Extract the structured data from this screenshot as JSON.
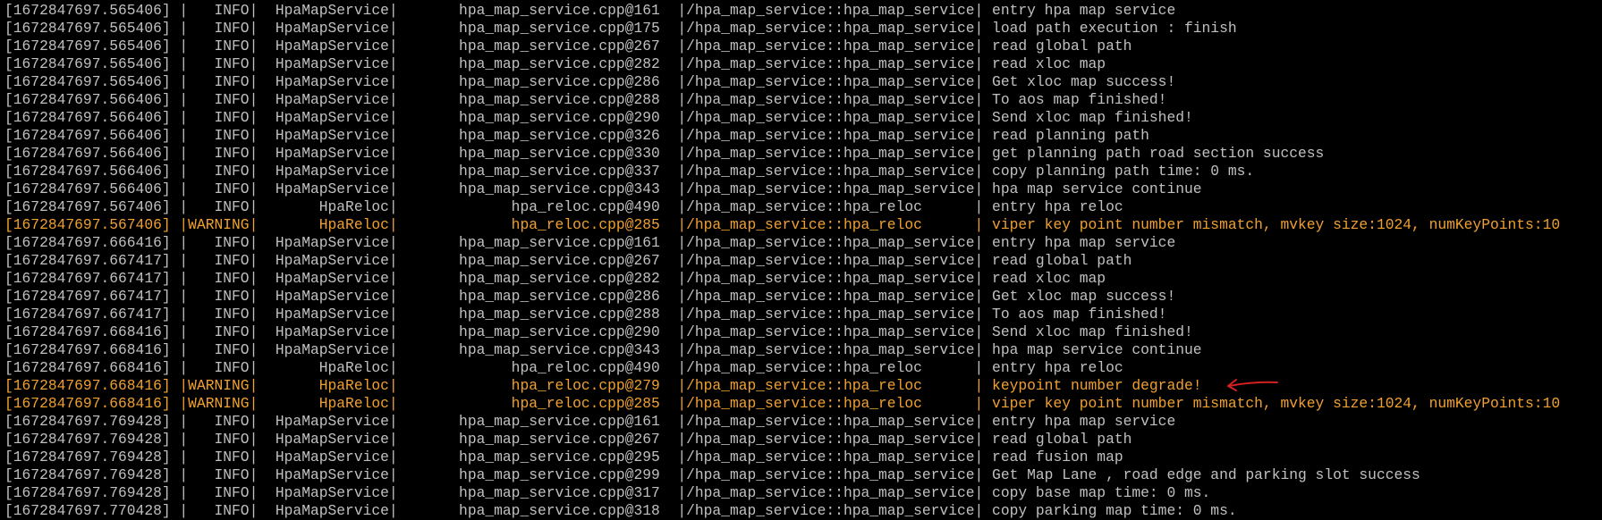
{
  "terminal": {
    "lines": [
      "[1672847697.565406] |   INFO|  HpaMapService|       hpa_map_service.cpp@161  |/hpa_map_service::hpa_map_service| entry hpa map service",
      "[1672847697.565406] |   INFO|  HpaMapService|       hpa_map_service.cpp@175  |/hpa_map_service::hpa_map_service| load path execution : finish",
      "[1672847697.565406] |   INFO|  HpaMapService|       hpa_map_service.cpp@267  |/hpa_map_service::hpa_map_service| read global path",
      "[1672847697.565406] |   INFO|  HpaMapService|       hpa_map_service.cpp@282  |/hpa_map_service::hpa_map_service| read xloc map",
      "[1672847697.565406] |   INFO|  HpaMapService|       hpa_map_service.cpp@286  |/hpa_map_service::hpa_map_service| Get xloc map success!",
      "[1672847697.566406] |   INFO|  HpaMapService|       hpa_map_service.cpp@288  |/hpa_map_service::hpa_map_service| To aos map finished!",
      "[1672847697.566406] |   INFO|  HpaMapService|       hpa_map_service.cpp@290  |/hpa_map_service::hpa_map_service| Send xloc map finished!",
      "[1672847697.566406] |   INFO|  HpaMapService|       hpa_map_service.cpp@326  |/hpa_map_service::hpa_map_service| read planning path",
      "[1672847697.566406] |   INFO|  HpaMapService|       hpa_map_service.cpp@330  |/hpa_map_service::hpa_map_service| get planning path road section success",
      "[1672847697.566406] |   INFO|  HpaMapService|       hpa_map_service.cpp@337  |/hpa_map_service::hpa_map_service| copy planning path time: 0 ms.",
      "[1672847697.566406] |   INFO|  HpaMapService|       hpa_map_service.cpp@343  |/hpa_map_service::hpa_map_service| hpa map service continue",
      "[1672847697.567406] |   INFO|       HpaReloc|             hpa_reloc.cpp@490  |/hpa_map_service::hpa_reloc      | entry hpa reloc",
      "[1672847697.567406] |WARNING|       HpaReloc|             hpa_reloc.cpp@285  |/hpa_map_service::hpa_reloc      | viper key point number mismatch, mvkey size:1024, numKeyPoints:10",
      "[1672847697.666416] |   INFO|  HpaMapService|       hpa_map_service.cpp@161  |/hpa_map_service::hpa_map_service| entry hpa map service",
      "[1672847697.667417] |   INFO|  HpaMapService|       hpa_map_service.cpp@267  |/hpa_map_service::hpa_map_service| read global path",
      "[1672847697.667417] |   INFO|  HpaMapService|       hpa_map_service.cpp@282  |/hpa_map_service::hpa_map_service| read xloc map",
      "[1672847697.667417] |   INFO|  HpaMapService|       hpa_map_service.cpp@286  |/hpa_map_service::hpa_map_service| Get xloc map success!",
      "[1672847697.667417] |   INFO|  HpaMapService|       hpa_map_service.cpp@288  |/hpa_map_service::hpa_map_service| To aos map finished!",
      "[1672847697.668416] |   INFO|  HpaMapService|       hpa_map_service.cpp@290  |/hpa_map_service::hpa_map_service| Send xloc map finished!",
      "[1672847697.668416] |   INFO|  HpaMapService|       hpa_map_service.cpp@343  |/hpa_map_service::hpa_map_service| hpa map service continue",
      "[1672847697.668416] |   INFO|       HpaReloc|             hpa_reloc.cpp@490  |/hpa_map_service::hpa_reloc      | entry hpa reloc",
      "[1672847697.668416] |WARNING|       HpaReloc|             hpa_reloc.cpp@279  |/hpa_map_service::hpa_reloc      | keypoint number degrade!",
      "[1672847697.668416] |WARNING|       HpaReloc|             hpa_reloc.cpp@285  |/hpa_map_service::hpa_reloc      | viper key point number mismatch, mvkey size:1024, numKeyPoints:10",
      "[1672847697.769428] |   INFO|  HpaMapService|       hpa_map_service.cpp@161  |/hpa_map_service::hpa_map_service| entry hpa map service",
      "[1672847697.769428] |   INFO|  HpaMapService|       hpa_map_service.cpp@267  |/hpa_map_service::hpa_map_service| read global path",
      "[1672847697.769428] |   INFO|  HpaMapService|       hpa_map_service.cpp@295  |/hpa_map_service::hpa_map_service| read fusion map",
      "[1672847697.769428] |   INFO|  HpaMapService|       hpa_map_service.cpp@299  |/hpa_map_service::hpa_map_service| Get Map Lane , road edge and parking slot success",
      "[1672847697.769428] |   INFO|  HpaMapService|       hpa_map_service.cpp@317  |/hpa_map_service::hpa_map_service| copy base map time: 0 ms.",
      "[1672847697.770428] |   INFO|  HpaMapService|       hpa_map_service.cpp@318  |/hpa_map_service::hpa_map_service| copy parking map time: 0 ms."
    ]
  }
}
